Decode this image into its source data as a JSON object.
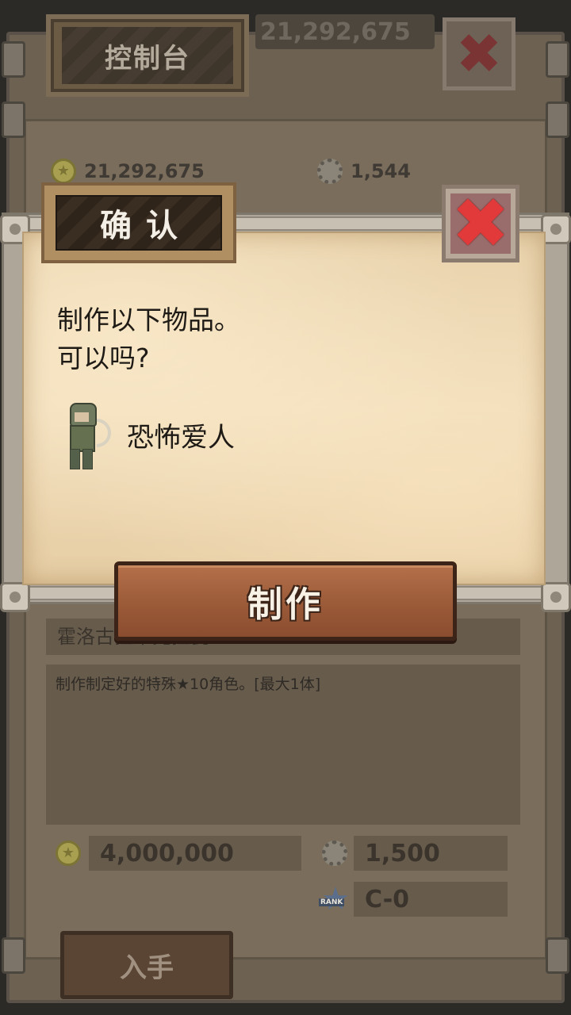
{
  "background_panel": {
    "title": "控制台",
    "top_counter": "21,292,675",
    "gold_amount": "21,292,675",
    "gear_amount": "1,544",
    "item_name": "霍洛古拉呆克拉瓦",
    "description": "制作制定好的特殊★10角色。[最大1体]",
    "cost_gold": "4,000,000",
    "cost_gear": "1,500",
    "rank_icon_text": "RANK",
    "rank_value": "C-0",
    "acquire_label": "入手"
  },
  "dialog": {
    "title": "确认",
    "message_line1": "制作以下物品。",
    "message_line2": "可以吗?",
    "item_name": "恐怖爱人",
    "make_button_label": "制作",
    "close_glyph": "✖"
  },
  "icons": {
    "coin": "coin-icon",
    "gear": "gear-icon",
    "rank": "rank-star-icon",
    "close": "close-icon"
  },
  "colors": {
    "close_x": "#e23a3a",
    "make_button": "#9d5c3a",
    "paper": "#ecd6b0"
  }
}
